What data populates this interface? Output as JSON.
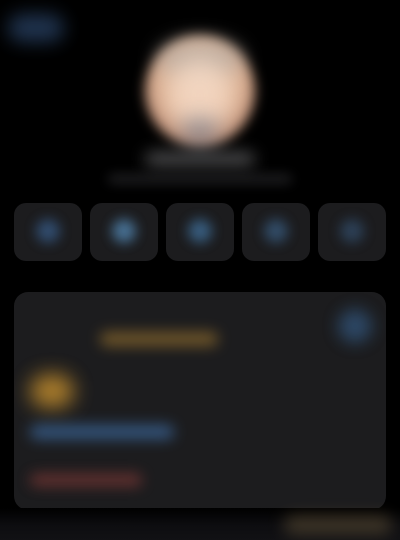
{
  "top_bar": {
    "back_button_label": ""
  },
  "profile": {
    "name": "",
    "subtitle": ""
  },
  "actions": [
    {
      "label": "",
      "icon": "message-icon",
      "color": "#35557d"
    },
    {
      "label": "",
      "icon": "phone-icon",
      "color": "#4f7fa8"
    },
    {
      "label": "",
      "icon": "video-icon",
      "color": "#3d688f"
    },
    {
      "label": "",
      "icon": "mail-icon",
      "color": "#365575"
    },
    {
      "label": "",
      "icon": "more-icon",
      "color": "#304761"
    }
  ],
  "details": {
    "field_title": "",
    "field_value": "",
    "chat_icon": "chat-icon"
  },
  "footer": {
    "label": ""
  }
}
